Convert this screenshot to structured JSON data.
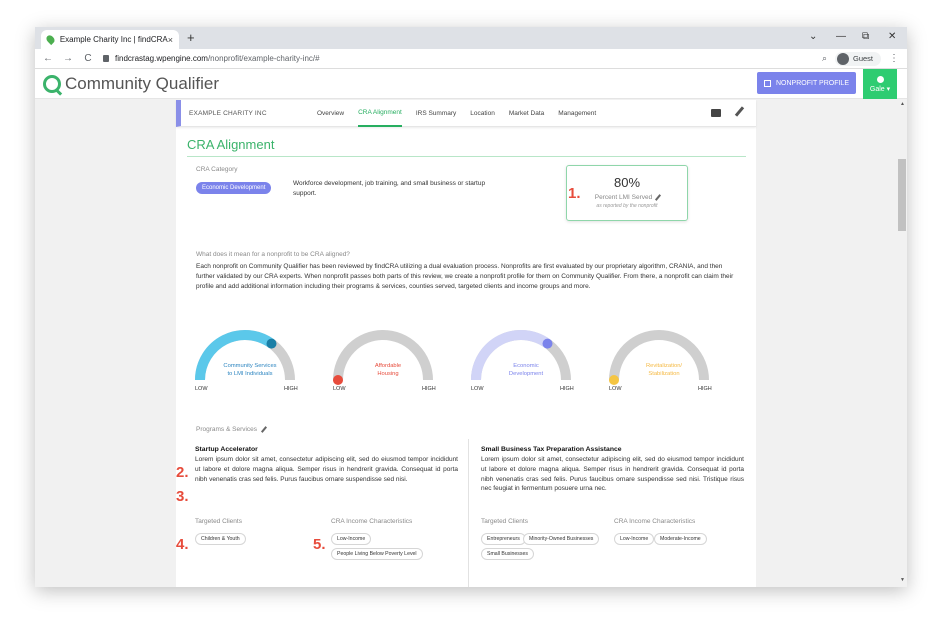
{
  "browser": {
    "tab_title": "Example Charity Inc | findCRA",
    "tab_close": "×",
    "new_tab": "+",
    "nav_back": "←",
    "nav_forward": "→",
    "nav_reload": "C",
    "url_host": "findcrastag.wpengine.com",
    "url_path": "/nonprofit/example-charity-inc/#",
    "profile": "Guest",
    "win_min": "—",
    "win_max": "⧉",
    "win_close": "✕",
    "tab_chevron": "⌄"
  },
  "header": {
    "brand": "Community Qualifier",
    "nonprofit_profile_button": "NONPROFIT PROFILE",
    "user_button": "Gale ▾"
  },
  "subnav": {
    "org_name": "EXAMPLE CHARITY INC",
    "tabs": [
      "Overview",
      "CRA Alignment",
      "IRS Summary",
      "Location",
      "Market Data",
      "Management"
    ],
    "active_tab": "CRA Alignment"
  },
  "section_title": "CRA Alignment",
  "cra": {
    "category_label": "CRA Category",
    "category_pill": "Economic Development",
    "category_desc": "Workforce development, job training, and small business or startup support.",
    "lmi_percent": "80%",
    "lmi_label": "Percent LMI Served",
    "lmi_note": "as reported by the nonprofit"
  },
  "annotations": [
    "1.",
    "2.",
    "3.",
    "4.",
    "5."
  ],
  "what": {
    "title": "What does it mean for a nonprofit to be CRA aligned?",
    "text": "Each nonprofit on Community Qualifier has been reviewed by findCRA utilizing a dual evaluation process. Nonprofits are first evaluated by our proprietary algorithm, CRANIA, and then further validated by our CRA experts. When nonprofit passes both parts of this review, we create a nonprofit profile for them on Community Qualifier. From there, a nonprofit can claim their profile and add additional information including their programs & services, counties served, targeted clients and income groups and more."
  },
  "gauges": [
    {
      "line1": "Community Services",
      "line2": "to LMI Individuals",
      "color": "#5bc8ea",
      "label_color": "#2e86c1",
      "level": 1.0,
      "dot_color": "#1a7fa6",
      "low": "LOW",
      "high": "HIGH"
    },
    {
      "line1": "Affordable",
      "line2": "Housing",
      "color": "#cfcfcf",
      "label_color": "#e74c3c",
      "level": 0.0,
      "dot_color": "#e74c3c",
      "low": "LOW",
      "high": "HIGH"
    },
    {
      "line1": "Economic",
      "line2": "Development",
      "color": "#d1d4f7",
      "label_color": "#7b83eb",
      "level": 1.0,
      "dot_color": "#7b83eb",
      "low": "LOW",
      "high": "HIGH"
    },
    {
      "line1": "Revitalization/",
      "line2": "Stabilization",
      "color": "#cfcfcf",
      "label_color": "#f5b942",
      "level": 0.0,
      "dot_color": "#f5c542",
      "low": "LOW",
      "high": "HIGH"
    }
  ],
  "programs": {
    "title": "Programs & Services",
    "items": [
      {
        "name": "Startup Accelerator",
        "desc": "Lorem ipsum dolor sit amet, consectetur adipiscing elit, sed do eiusmod tempor incididunt ut labore et dolore magna aliqua. Semper risus in hendrerit gravida. Consequat id porta nibh venenatis cras sed felis. Purus faucibus ornare suspendisse sed nisi.",
        "targeted_label": "Targeted Clients",
        "income_label": "CRA Income Characteristics",
        "targeted": [
          "Children & Youth"
        ],
        "income": [
          "Low-Income",
          "People Living Below Poverty Level"
        ]
      },
      {
        "name": "Small Business Tax Preparation Assistance",
        "desc": "Lorem ipsum dolor sit amet, consectetur adipiscing elit, sed do eiusmod tempor incididunt ut labore et dolore magna aliqua. Semper risus in hendrerit gravida. Consequat id porta nibh venenatis cras sed felis. Purus faucibus ornare suspendisse sed nisi. Tristique risus nec feugiat in fermentum posuere urna nec.",
        "targeted_label": "Targeted Clients",
        "income_label": "CRA Income Characteristics",
        "targeted": [
          "Entrepreneurs",
          "Minority-Owned Businesses",
          "Small Businesses"
        ],
        "income": [
          "Low-Income",
          "Moderate-Income"
        ]
      }
    ]
  }
}
